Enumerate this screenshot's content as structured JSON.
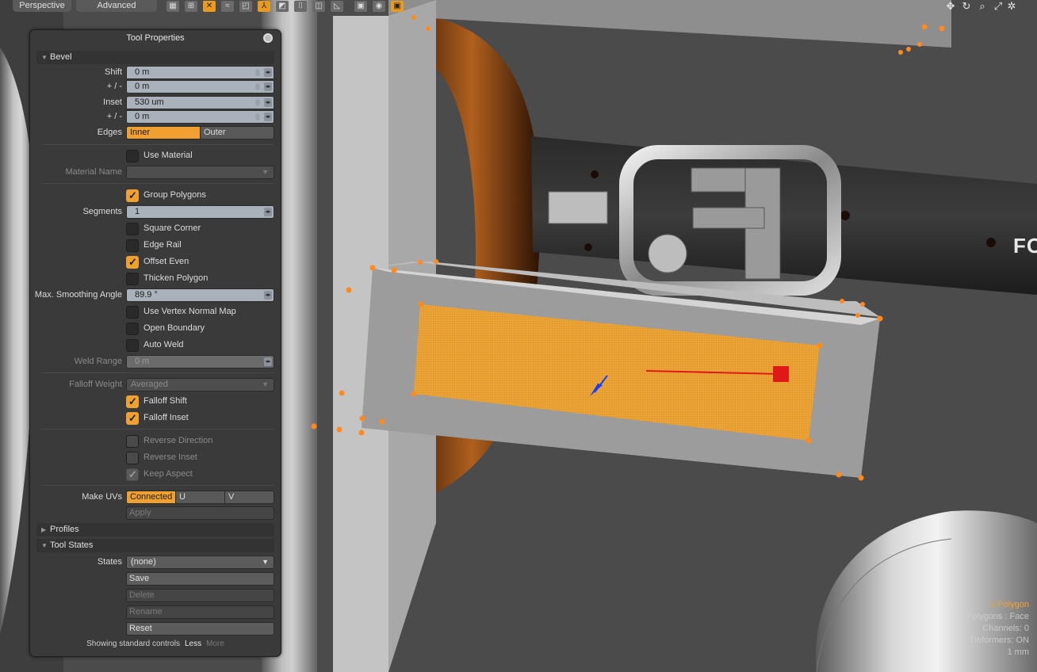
{
  "viewport": {
    "tab_view": "Perspective",
    "tab_mode": "Advanced",
    "brand_text": "FO"
  },
  "toolbar_icons": [
    "checker-icon",
    "grid-icon",
    "x-ray-icon",
    "wave-icon",
    "layers-icon",
    "axis-icon",
    "uv-icon",
    "mirror-icon",
    "backface-icon",
    "snap-icon",
    "camera-icon",
    "active-render-icon"
  ],
  "nav_icons": [
    "move-view-icon",
    "rotate-view-icon",
    "zoom-view-icon",
    "fit-view-icon",
    "settings-icon"
  ],
  "panel": {
    "title": "Tool Properties",
    "bevel": {
      "header": "Bevel",
      "shift_label": "Shift",
      "shift_value": "0 m",
      "shift_pm_label": "+ / -",
      "shift_pm_value": "0 m",
      "inset_label": "Inset",
      "inset_value": "530 um",
      "inset_pm_label": "+ / -",
      "inset_pm_value": "0 m",
      "edges_label": "Edges",
      "edges_options": [
        "Inner",
        "Outer"
      ],
      "edges_selected": "Inner",
      "use_material_label": "Use Material",
      "use_material": false,
      "material_name_label": "Material Name",
      "material_name_value": "",
      "group_polygons_label": "Group Polygons",
      "group_polygons": true,
      "segments_label": "Segments",
      "segments_value": "1",
      "square_corner_label": "Square Corner",
      "square_corner": false,
      "edge_rail_label": "Edge Rail",
      "edge_rail": false,
      "offset_even_label": "Offset Even",
      "offset_even": true,
      "thicken_polygon_label": "Thicken Polygon",
      "thicken_polygon": false,
      "max_smoothing_label": "Max. Smoothing Angle",
      "max_smoothing_value": "89.9 °",
      "use_vertex_normal_label": "Use Vertex Normal Map",
      "use_vertex_normal": false,
      "open_boundary_label": "Open Boundary",
      "open_boundary": false,
      "auto_weld_label": "Auto Weld",
      "auto_weld": false,
      "weld_range_label": "Weld Range",
      "weld_range_value": "0 m",
      "falloff_weight_label": "Falloff Weight",
      "falloff_weight_value": "Averaged",
      "falloff_shift_label": "Falloff Shift",
      "falloff_shift": true,
      "falloff_inset_label": "Falloff Inset",
      "falloff_inset": true,
      "reverse_direction_label": "Reverse Direction",
      "reverse_direction": false,
      "reverse_inset_label": "Reverse Inset",
      "reverse_inset": false,
      "keep_aspect_label": "Keep Aspect",
      "keep_aspect": true,
      "make_uvs_label": "Make UVs",
      "make_uvs_options": [
        "Connected",
        "U",
        "V"
      ],
      "make_uvs_selected": "Connected",
      "apply_label": "Apply"
    },
    "profiles_header": "Profiles",
    "tool_states": {
      "header": "Tool States",
      "states_label": "States",
      "states_value": "(none)",
      "save_label": "Save",
      "delete_label": "Delete",
      "rename_label": "Rename",
      "reset_label": "Reset"
    },
    "footer": {
      "text": "Showing standard controls",
      "less": "Less",
      "more": "More"
    }
  },
  "hud": {
    "selection": "1 Polygon",
    "polygons": "Polygons : Face",
    "channels": "Channels: 0",
    "deformers": "Deformers: ON",
    "last": "1 mm"
  },
  "colors": {
    "accent": "#f0a030",
    "panel_bg": "#3a3a3a",
    "field_bg": "#a9b2bb",
    "selection_face": "#e9a335",
    "vertex": "#ff8a1e",
    "handle_red": "#e01818",
    "handle_blue": "#1a3cff",
    "background": "#4a4a4a"
  }
}
